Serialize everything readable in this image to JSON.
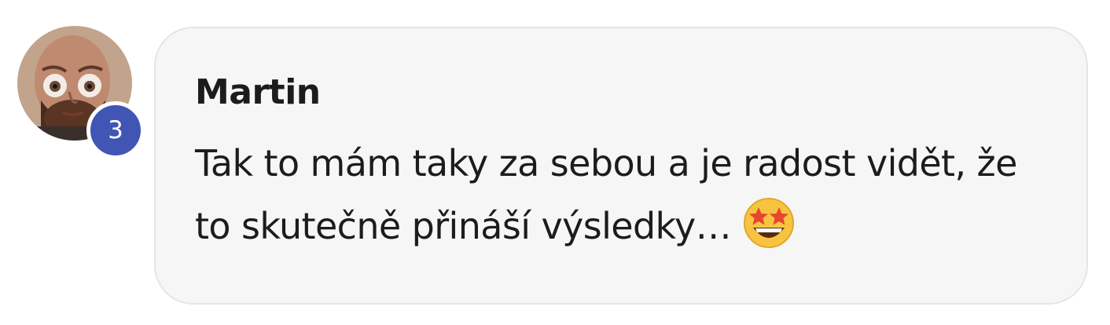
{
  "comment": {
    "author": "Martin",
    "badge_count": "3",
    "text": "Tak to mám taky za sebou a je radost vidět, že to skutečně přináší výsledky…",
    "emoji": "star-struck-emoji"
  },
  "colors": {
    "badge": "#4155b5",
    "bubble_bg": "#f6f6f6",
    "bubble_border": "#e5e5e5",
    "text": "#1c1c1c"
  }
}
